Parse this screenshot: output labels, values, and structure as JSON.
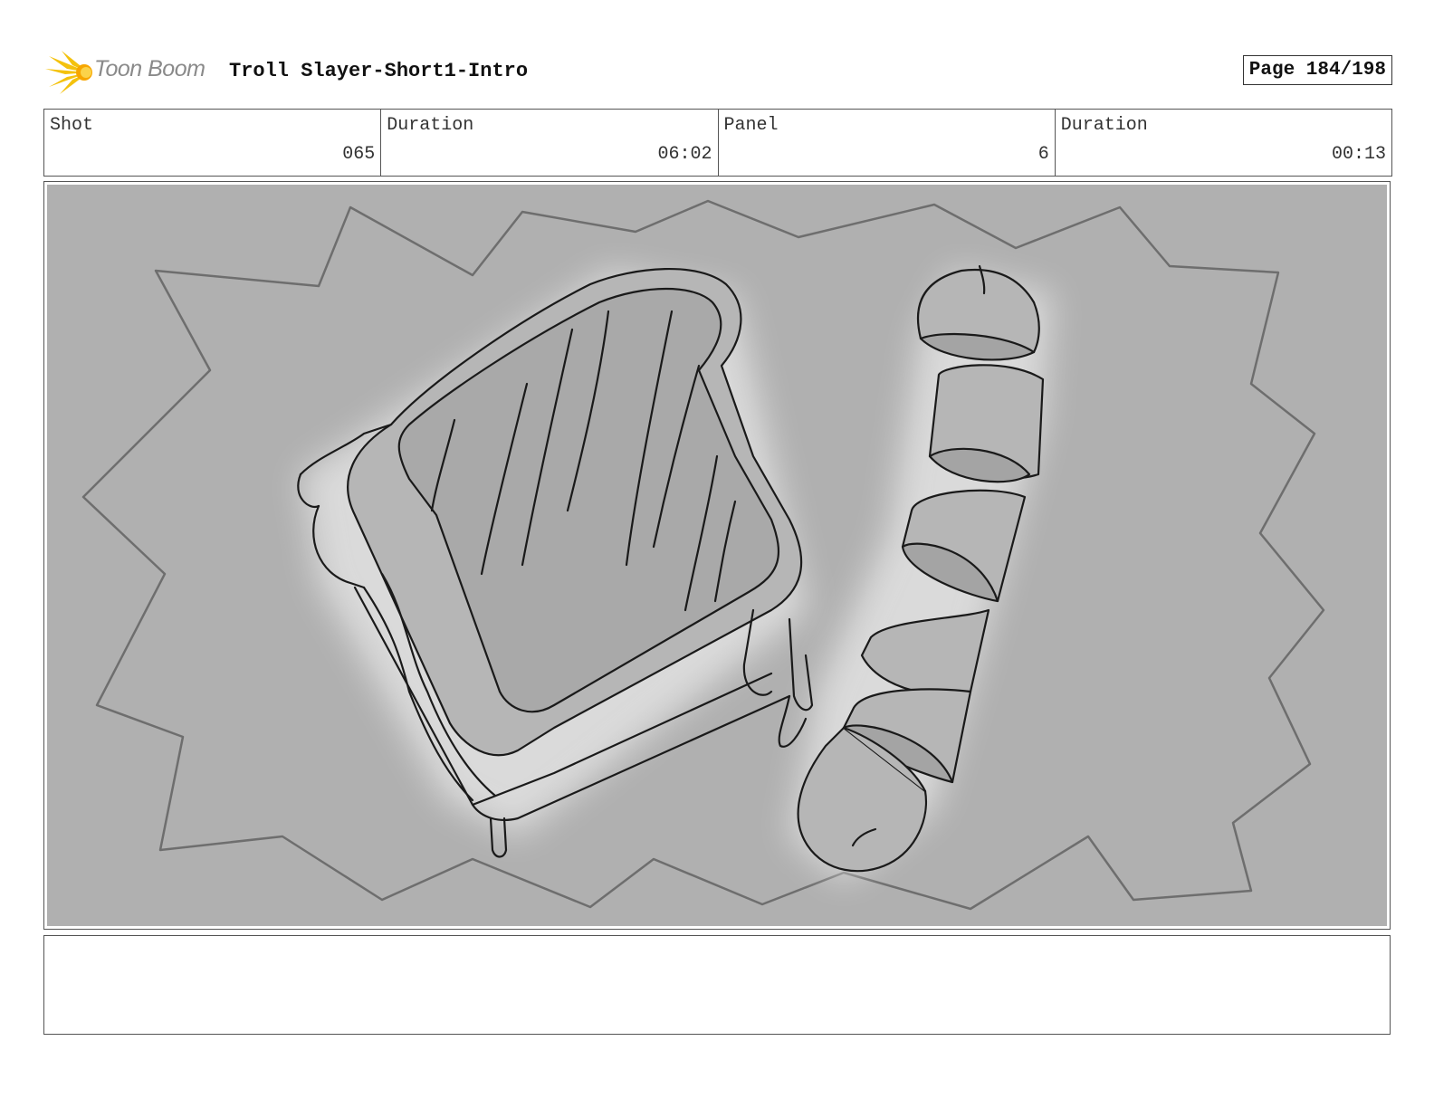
{
  "header": {
    "logo_text": "Toon Boom",
    "project_title": "Troll Slayer-Short1-Intro",
    "page_label": "Page 184/198"
  },
  "info": {
    "shot_label": "Shot",
    "shot_value": "065",
    "shot_duration_label": "Duration",
    "shot_duration_value": "06:02",
    "panel_label": "Panel",
    "panel_value": "6",
    "panel_duration_label": "Duration",
    "panel_duration_value": "00:13"
  },
  "panel": {
    "background_color": "#b0b0b0",
    "line_color": "#1a1a1a",
    "burst_color": "#6e6e6e",
    "glow_color": "#e8e8e8"
  },
  "notes": {
    "text": ""
  }
}
